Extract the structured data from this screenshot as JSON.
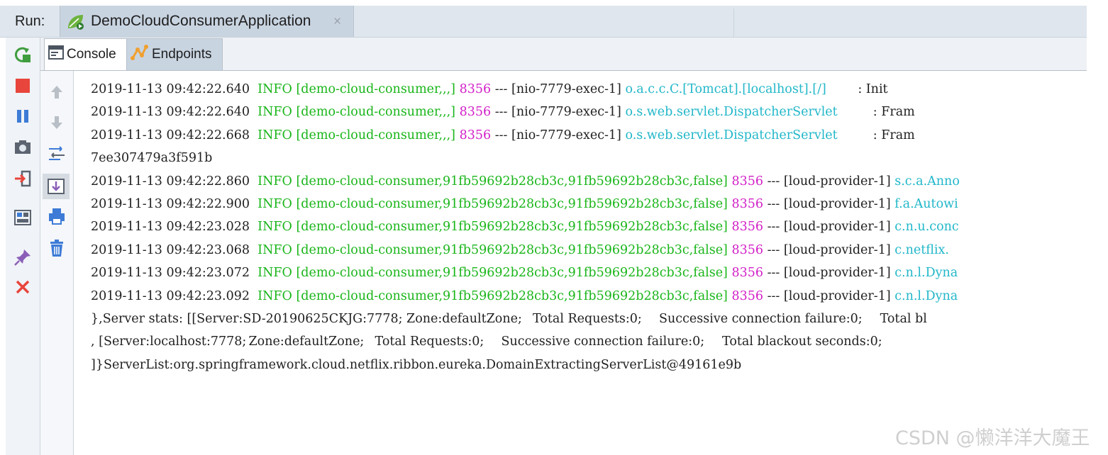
{
  "runbar": {
    "label": "Run:",
    "tab_title": "DemoCloudConsumerApplication",
    "close_glyph": "×"
  },
  "subtabs": {
    "console": "Console",
    "endpoints": "Endpoints"
  },
  "left_toolbar": {
    "icons": [
      "rerun-icon",
      "stop-icon",
      "pause-icon",
      "screenshot-icon",
      "exit-icon",
      "layout-icon",
      "pin-icon",
      "close-icon"
    ]
  },
  "second_toolbar": {
    "icons": [
      "scroll-up-icon",
      "scroll-down-icon",
      "soft-wrap-icon",
      "scroll-to-end-icon",
      "print-icon",
      "clear-all-icon"
    ]
  },
  "colors": {
    "info": "#19b519",
    "pid": "#d21fc7",
    "logger": "#21b7c9",
    "stop": "#e8453c",
    "pause": "#3d7bd6"
  },
  "console": {
    "lines": [
      {
        "ts": "2019-11-13 09:42:22.640",
        "level": "INFO",
        "ctx": "[demo-cloud-consumer,,,]",
        "pid": "8356",
        "sep": "---",
        "thread": "[nio-7779-exec-1]",
        "logger": "o.a.c.c.C.[Tomcat].[localhost].[/]",
        "tail": "       : Init"
      },
      {
        "ts": "2019-11-13 09:42:22.640",
        "level": "INFO",
        "ctx": "[demo-cloud-consumer,,,]",
        "pid": "8356",
        "sep": "---",
        "thread": "[nio-7779-exec-1]",
        "logger": "o.s.web.servlet.DispatcherServlet",
        "tail": "        : Fram"
      },
      {
        "ts": "2019-11-13 09:42:22.668",
        "level": "INFO",
        "ctx": "[demo-cloud-consumer,,,]",
        "pid": "8356",
        "sep": "---",
        "thread": "[nio-7779-exec-1]",
        "logger": "o.s.web.servlet.DispatcherServlet",
        "tail": "        : Fram"
      },
      {
        "plain": "7ee307479a3f591b"
      },
      {
        "ts": "2019-11-13 09:42:22.860",
        "level": "INFO",
        "ctx": "[demo-cloud-consumer,91fb59692b28cb3c,91fb59692b28cb3c,false]",
        "pid": "8356",
        "sep": "---",
        "thread": "[loud-provider-1]",
        "logger": "s.c.a.Anno",
        "tail": ""
      },
      {
        "ts": "2019-11-13 09:42:22.900",
        "level": "INFO",
        "ctx": "[demo-cloud-consumer,91fb59692b28cb3c,91fb59692b28cb3c,false]",
        "pid": "8356",
        "sep": "---",
        "thread": "[loud-provider-1]",
        "logger": "f.a.Autowi",
        "tail": ""
      },
      {
        "ts": "2019-11-13 09:42:23.028",
        "level": "INFO",
        "ctx": "[demo-cloud-consumer,91fb59692b28cb3c,91fb59692b28cb3c,false]",
        "pid": "8356",
        "sep": "---",
        "thread": "[loud-provider-1]",
        "logger": "c.n.u.conc",
        "tail": ""
      },
      {
        "ts": "2019-11-13 09:42:23.068",
        "level": "INFO",
        "ctx": "[demo-cloud-consumer,91fb59692b28cb3c,91fb59692b28cb3c,false]",
        "pid": "8356",
        "sep": "---",
        "thread": "[loud-provider-1]",
        "logger": "c.netflix.",
        "tail": ""
      },
      {
        "ts": "2019-11-13 09:42:23.072",
        "level": "INFO",
        "ctx": "[demo-cloud-consumer,91fb59692b28cb3c,91fb59692b28cb3c,false]",
        "pid": "8356",
        "sep": "---",
        "thread": "[loud-provider-1]",
        "logger": "c.n.l.Dyna",
        "tail": ""
      },
      {
        "ts": "2019-11-13 09:42:23.092",
        "level": "INFO",
        "ctx": "[demo-cloud-consumer,91fb59692b28cb3c,91fb59692b28cb3c,false]",
        "pid": "8356",
        "sep": "---",
        "thread": "[loud-provider-1]",
        "logger": "c.n.l.Dyna",
        "tail": ""
      },
      {
        "plain": "},Server stats: [[Server:SD-20190625CKJG:7778;\tZone:defaultZone;\tTotal Requests:0;\tSuccessive connection failure:0;\tTotal bl"
      },
      {
        "plain": ", [Server:localhost:7778;\tZone:defaultZone;\tTotal Requests:0;\tSuccessive connection failure:0;\tTotal blackout seconds:0;"
      },
      {
        "plain": "]}ServerList:org.springframework.cloud.netflix.ribbon.eureka.DomainExtractingServerList@49161e9b"
      }
    ]
  },
  "watermark": "CSDN @懒洋洋大魔王"
}
